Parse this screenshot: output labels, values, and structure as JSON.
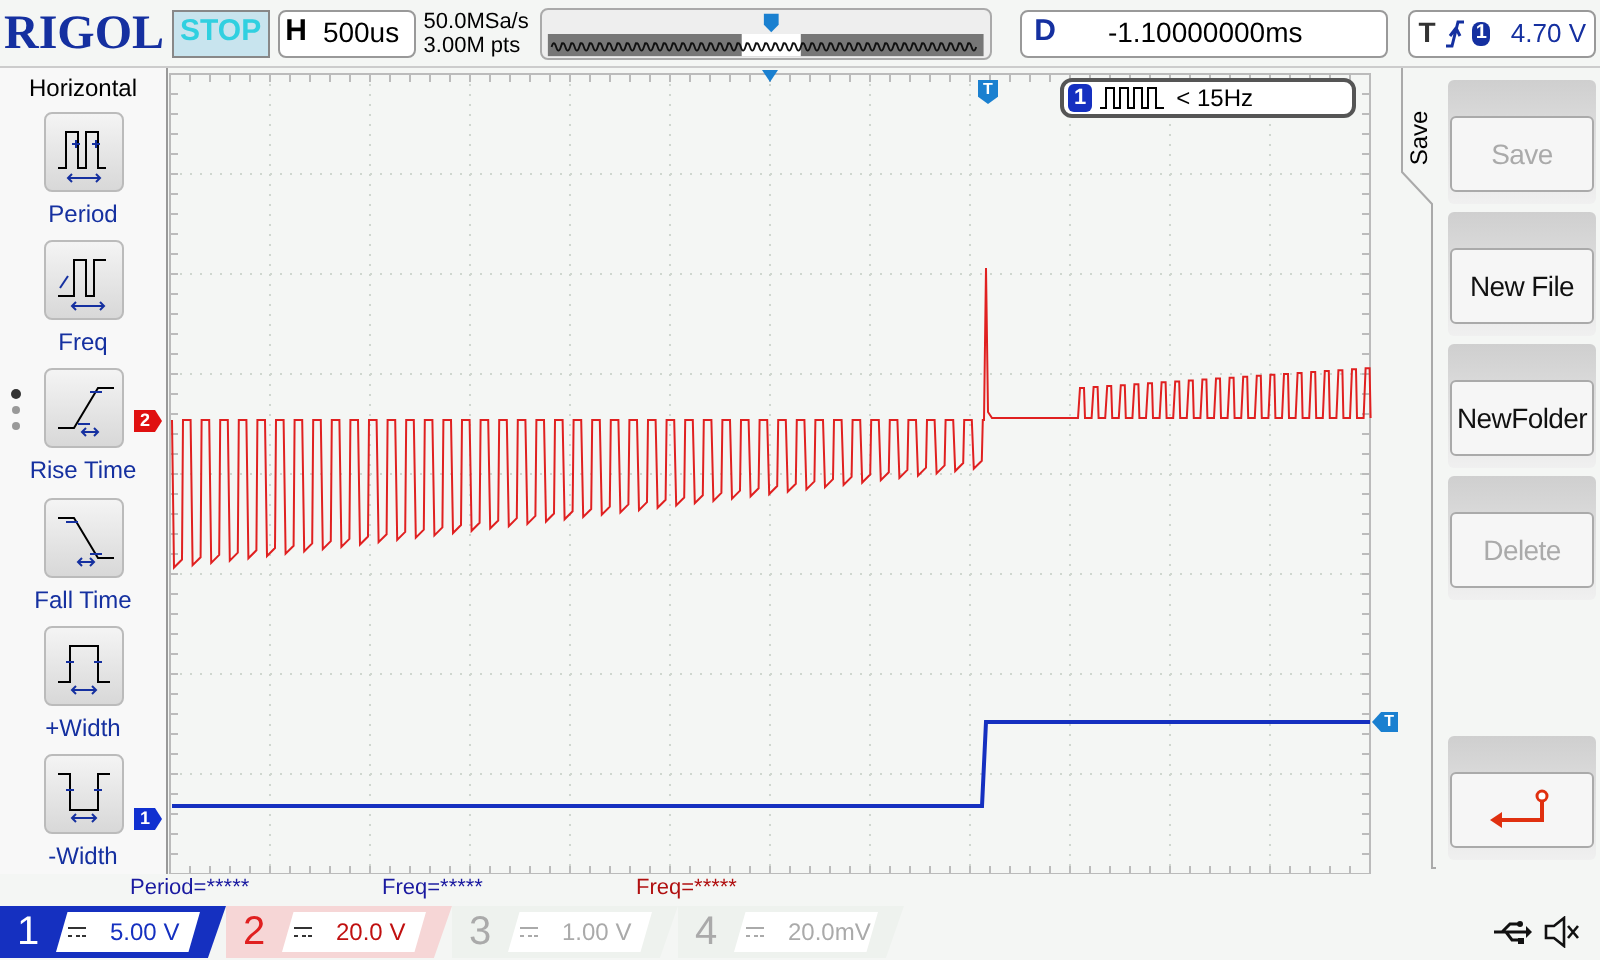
{
  "top_bar": {
    "logo": "RIGOL",
    "run_state": "STOP",
    "timebase": {
      "label": "H",
      "value": "500us"
    },
    "sample_rate": "50.0MSa/s",
    "memory_depth": "3.00M pts",
    "delay": {
      "label": "D",
      "value": "-1.10000000ms"
    },
    "trigger": {
      "label": "T",
      "source": "1",
      "level": "4.70 V"
    }
  },
  "left_menu": {
    "title": "Horizontal",
    "items": [
      {
        "label": "Period",
        "kind": "period"
      },
      {
        "label": "Freq",
        "kind": "freq"
      },
      {
        "label": "Rise Time",
        "kind": "rise"
      },
      {
        "label": "Fall Time",
        "kind": "fall"
      },
      {
        "label": "+Width",
        "kind": "pwidth"
      },
      {
        "label": "-Width",
        "kind": "nwidth"
      }
    ]
  },
  "screen": {
    "channel_markers": [
      {
        "label": "2",
        "color": "#e01010"
      },
      {
        "label": "1",
        "color": "#1030d0"
      }
    ],
    "trigger_marker": "T",
    "trigger_level_marker": "T",
    "frequency_badge": {
      "channel": "1",
      "text": "< 15Hz"
    }
  },
  "measurements": [
    {
      "text": "Period=*****",
      "color": "#1a1aa0"
    },
    {
      "text": "Freq=*****",
      "color": "#1a1aa0"
    },
    {
      "text": "Freq=*****",
      "color": "#b01010"
    }
  ],
  "channels": [
    {
      "number": "1",
      "scale": "5.00 V",
      "enabled": true,
      "selected": true
    },
    {
      "number": "2",
      "scale": "20.0 V",
      "enabled": true,
      "selected": false
    },
    {
      "number": "3",
      "scale": "1.00 V",
      "enabled": false,
      "selected": false
    },
    {
      "number": "4",
      "scale": "20.0mV",
      "enabled": false,
      "selected": false
    }
  ],
  "right_menu": {
    "title": "Save",
    "buttons": [
      {
        "label": "Save",
        "disabled": true
      },
      {
        "label": "New File",
        "disabled": false
      },
      {
        "label": "NewFolder",
        "disabled": false
      },
      {
        "label": "Delete",
        "disabled": true
      }
    ]
  }
}
